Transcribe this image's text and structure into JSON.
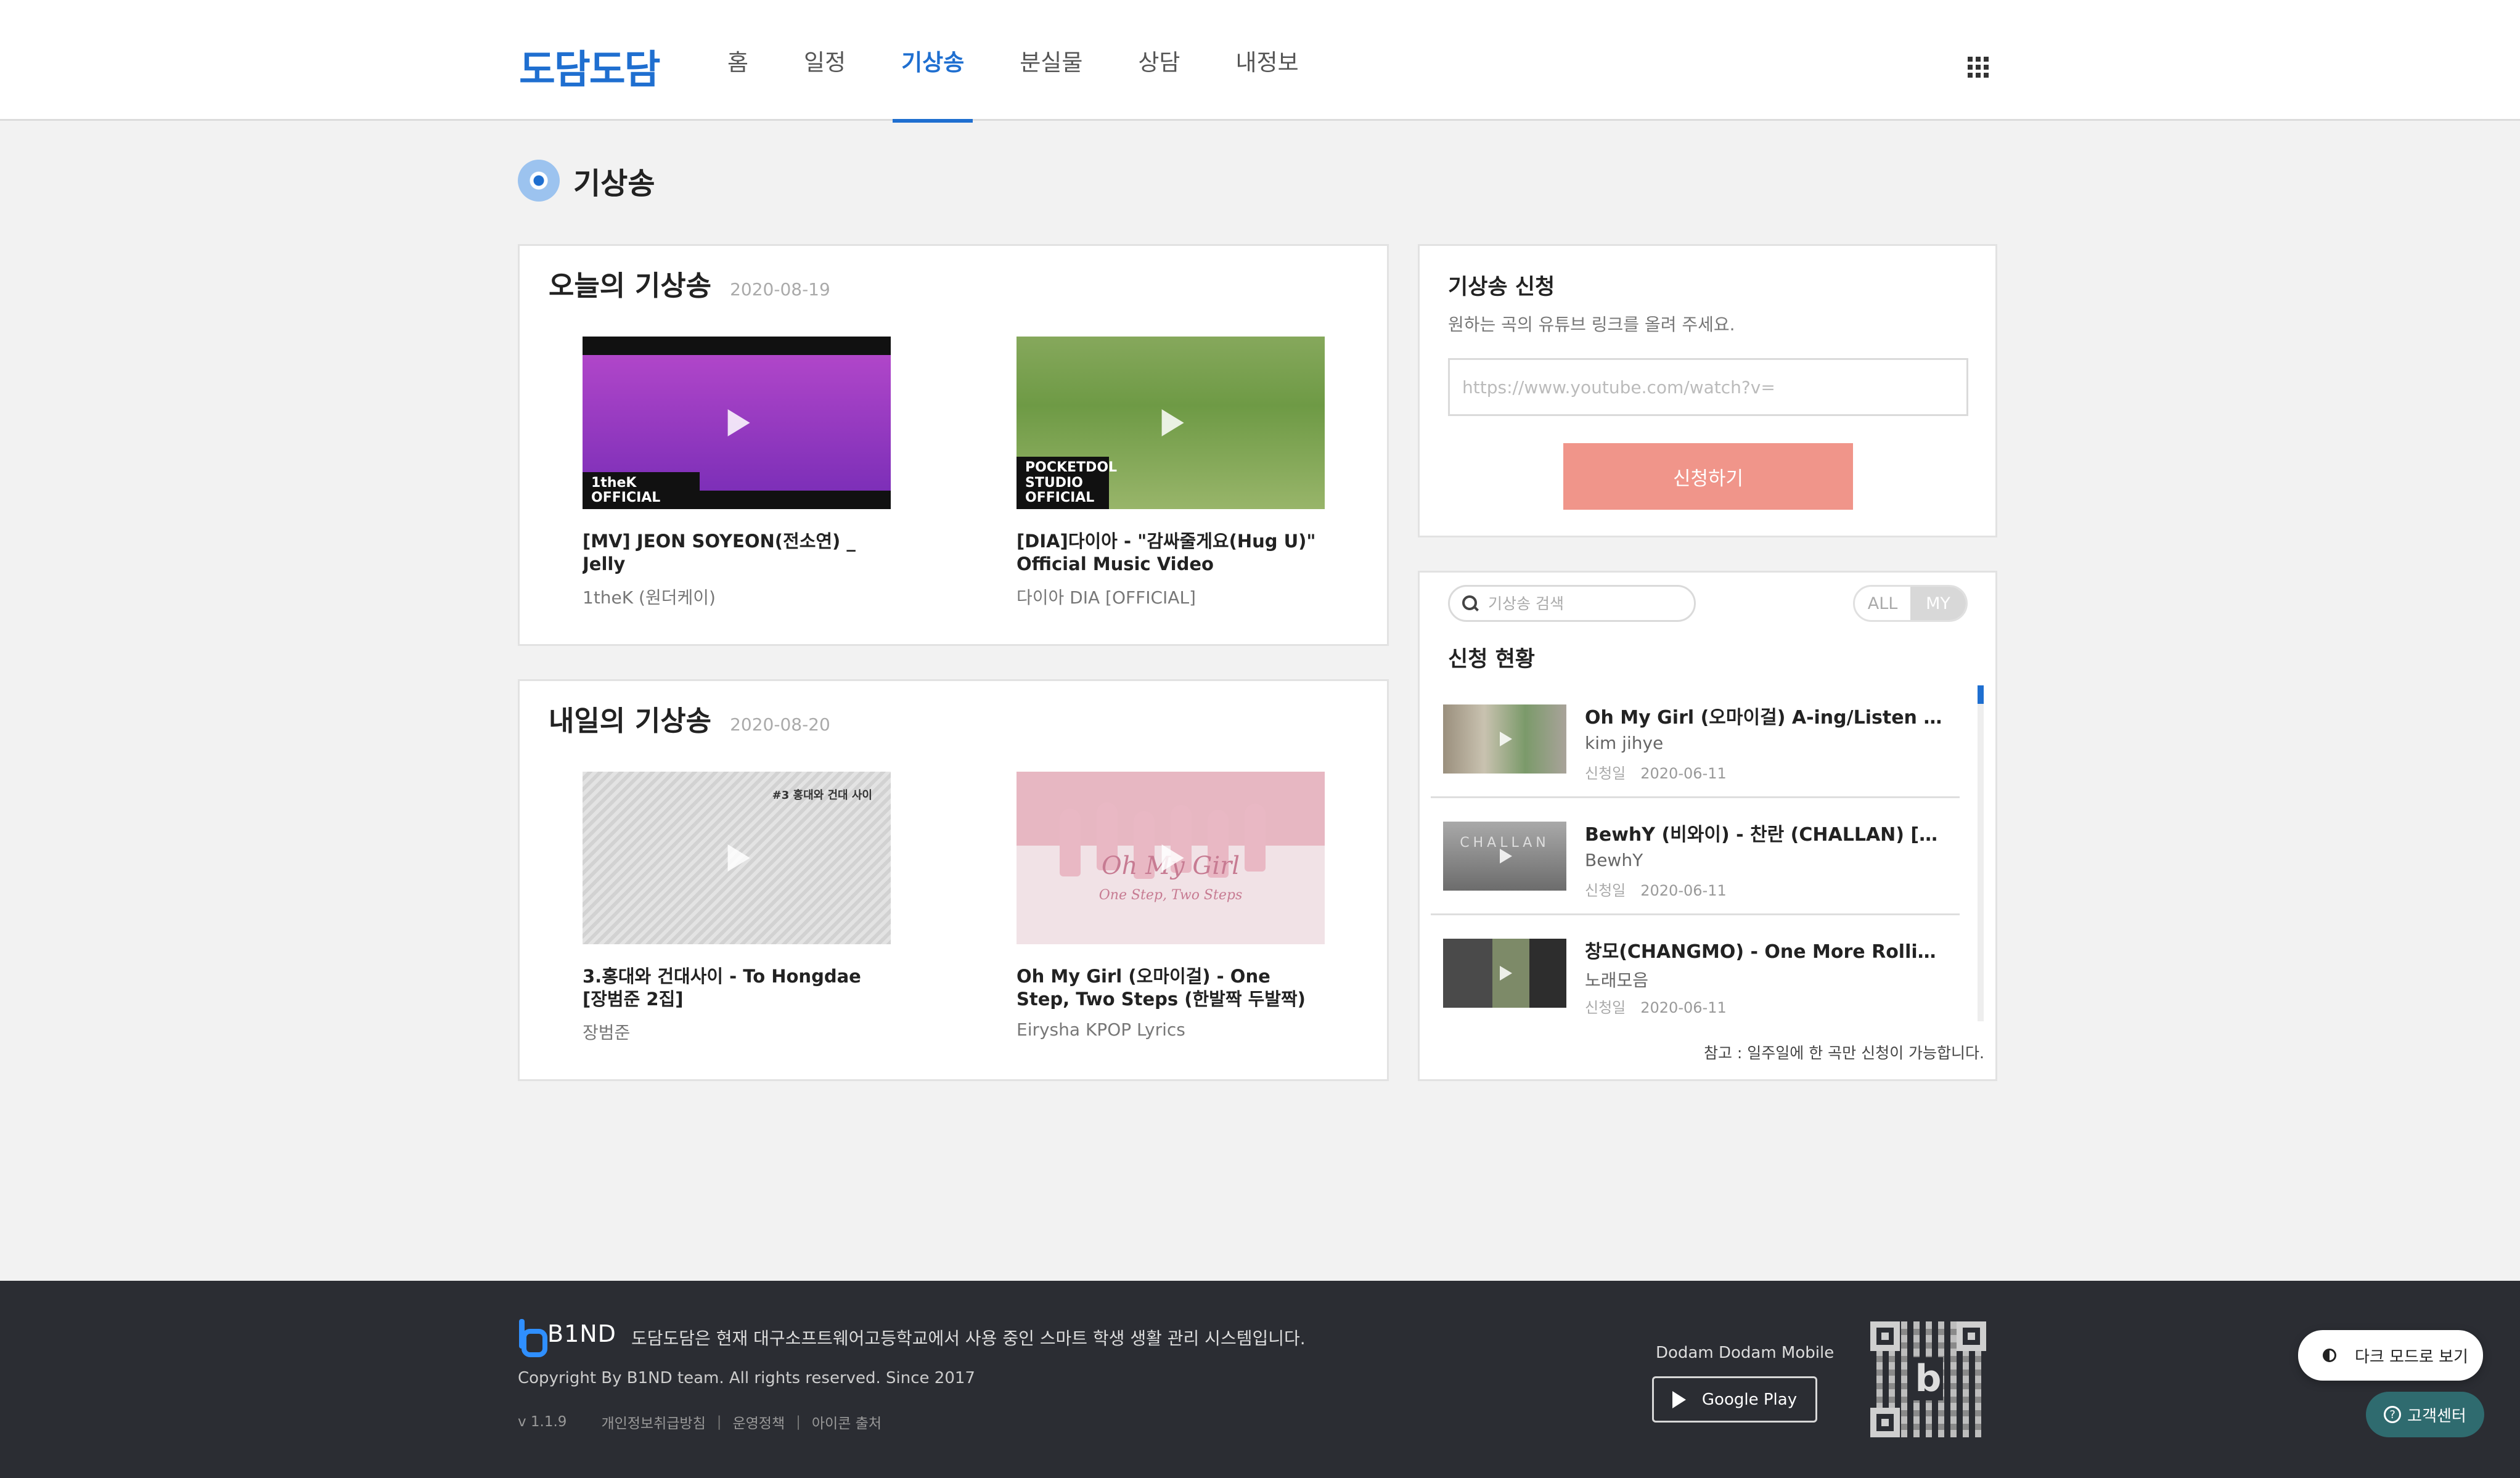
{
  "header": {
    "logo": "도담도담",
    "nav": [
      "홈",
      "일정",
      "기상송",
      "분실물",
      "상담",
      "내정보"
    ],
    "active_nav": "기상송"
  },
  "page": {
    "title": "기상송"
  },
  "today": {
    "title": "오늘의 기상송",
    "date": "2020-08-19",
    "videos": [
      {
        "title": "[MV] JEON SOYEON(전소연) _ Jelly",
        "channel": "1theK (원더케이)",
        "badge": "1theK OFFICIAL"
      },
      {
        "title": "[DIA]다이아 - \"감싸줄게요(Hug U)\" Official Music Video",
        "channel": "다이아 DIA [OFFICIAL]",
        "badge": "POCKETDOL STUDIO OFFICIAL"
      }
    ]
  },
  "tomorrow": {
    "title": "내일의 기상송",
    "date": "2020-08-20",
    "videos": [
      {
        "title": "3.홍대와 건대사이 - To Hongdae [장범준 2집]",
        "channel": "장범준",
        "thumb_text": "#3 홍대와 건대 사이"
      },
      {
        "title": "Oh My Girl (오마이걸) - One Step, Two Steps (한발짝 두발짝) (Han | Rom | E…",
        "channel": "Eirysha KPOP Lyrics",
        "thumb_text": "Oh My Girl",
        "thumb_sub": "One Step, Two Steps"
      }
    ]
  },
  "request": {
    "title": "기상송 신청",
    "description": "원하는 곡의 유튜브 링크를 올려 주세요.",
    "input_placeholder": "https://www.youtube.com/watch?v=",
    "input_value": "",
    "submit_label": "신청하기"
  },
  "status": {
    "search_placeholder": "기상송 검색",
    "toggle": [
      "ALL",
      "MY"
    ],
    "toggle_active": "MY",
    "title": "신청 현황",
    "date_label": "신청일",
    "items": [
      {
        "title": "Oh My Girl (오마이걸) A-ing/Listen ToMy(…",
        "user": "kim jihye",
        "date": "2020-06-11"
      },
      {
        "title": "BewhY (비와이) - 찬란 (CHALLAN) [Official …",
        "user": "BewhY",
        "date": "2020-06-11",
        "thumb_text": "CHALLAN"
      },
      {
        "title": "창모(CHANGMO) - One More Rollie(Feat.…",
        "user": "노래모음",
        "date": "2020-06-11"
      }
    ],
    "note": "참고 : 일주일에 한 곡만 신청이 가능합니다."
  },
  "footer": {
    "brand": "B1ND",
    "description": "도담도담은 현재 대구소프트웨어고등학교에서 사용 중인 스마트 학생 생활 관리 시스템입니다.",
    "copyright": "Copyright By B1ND team. All rights reserved. Since 2017",
    "version": "v 1.1.9",
    "links": [
      "개인정보취급방침",
      "운영정책",
      "아이콘 출처"
    ],
    "mobile_label": "Dodam Dodam Mobile",
    "google_play": "Google Play"
  },
  "floating": {
    "dark_mode": "다크 모드로 보기",
    "help": "고객센터"
  }
}
